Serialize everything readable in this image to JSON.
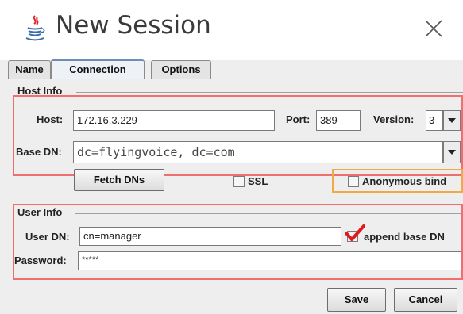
{
  "window": {
    "title": "New Session"
  },
  "tabs": [
    {
      "label": "Name",
      "active": false
    },
    {
      "label": "Connection",
      "active": true
    },
    {
      "label": "Options",
      "active": false
    }
  ],
  "host_info": {
    "title": "Host Info",
    "host_label": "Host:",
    "host_value": "172.16.3.229",
    "port_label": "Port:",
    "port_value": "389",
    "version_label": "Version:",
    "version_value": "3",
    "base_dn_label": "Base DN:",
    "base_dn_value": "dc=flyingvoice, dc=com",
    "fetch_dns_label": "Fetch DNs",
    "ssl_label": "SSL",
    "ssl_checked": false,
    "anonymous_bind_label": "Anonymous bind",
    "anonymous_bind_checked": false
  },
  "user_info": {
    "title": "User Info",
    "user_dn_label": "User DN:",
    "user_dn_value": "cn=manager",
    "append_label": "append base DN",
    "append_checked": true,
    "password_label": "Password:",
    "password_value": "*****"
  },
  "buttons": {
    "save": "Save",
    "cancel": "Cancel"
  },
  "colors": {
    "highlight_red": "#ef6f6f",
    "highlight_orange": "#f0a947",
    "checkmark": "#e01b1b",
    "java_red": "#e0262a",
    "java_blue": "#3a6ea5"
  }
}
